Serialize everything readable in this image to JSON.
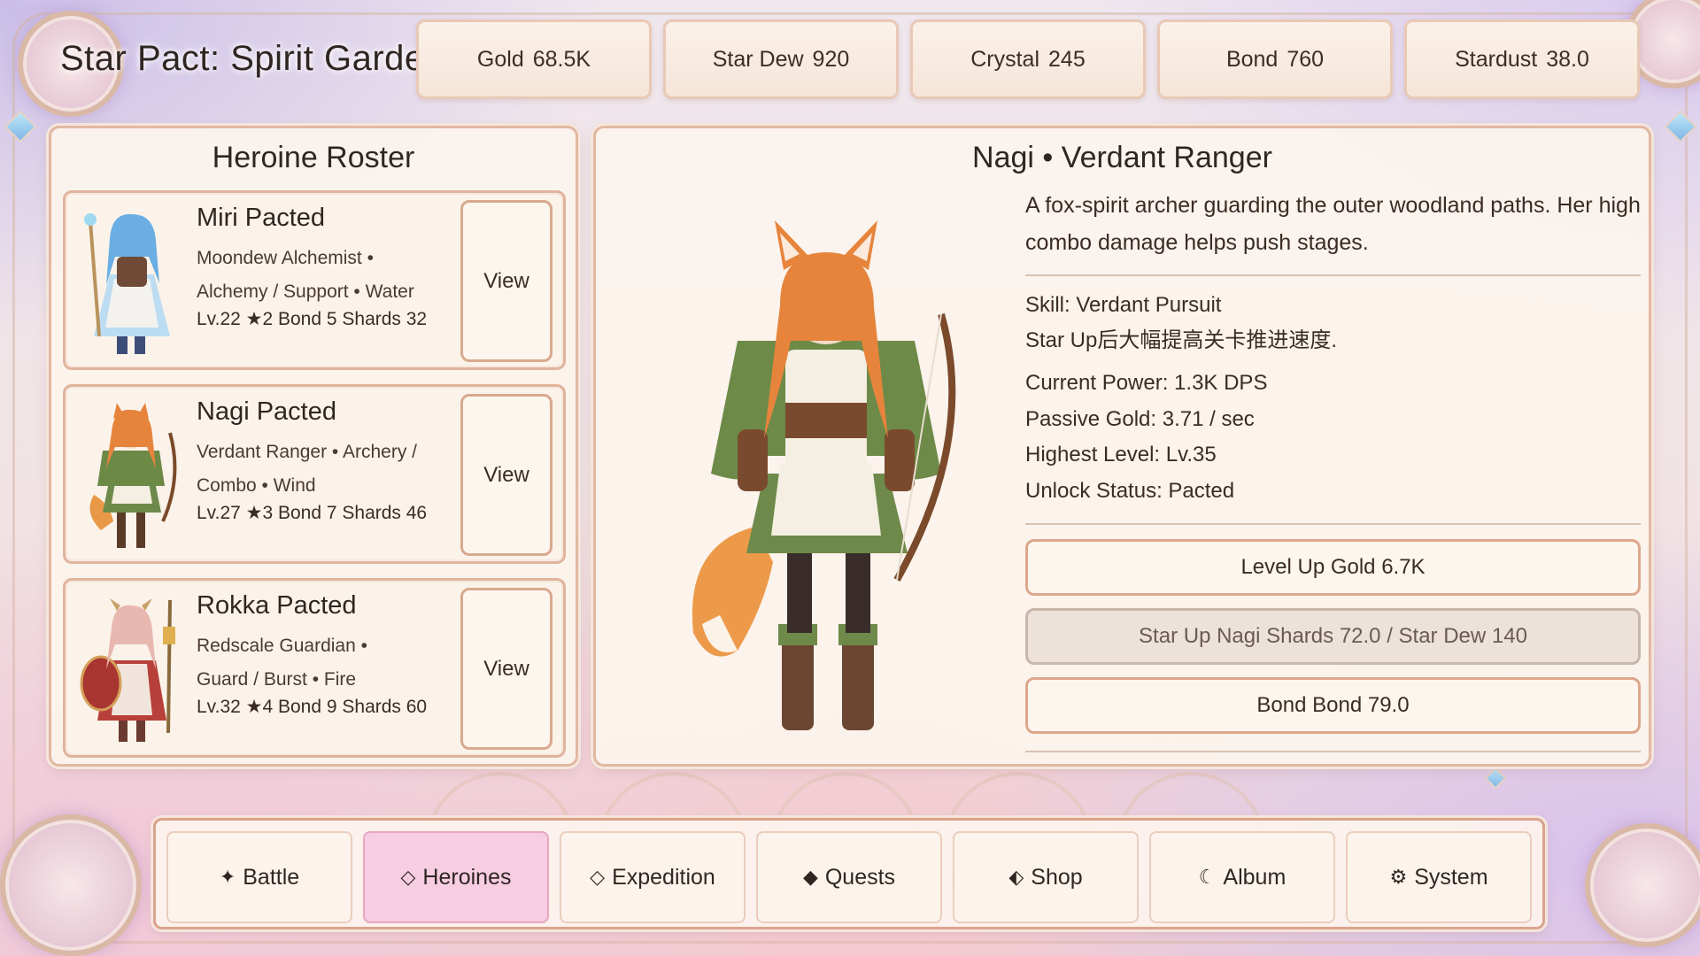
{
  "title": "Star Pact: Spirit Garden",
  "resources": [
    {
      "name": "Gold",
      "value": "68.5K"
    },
    {
      "name": "Star Dew",
      "value": "920"
    },
    {
      "name": "Crystal",
      "value": "245"
    },
    {
      "name": "Bond",
      "value": "760"
    },
    {
      "name": "Stardust",
      "value": "38.0"
    }
  ],
  "roster": {
    "title": "Heroine Roster",
    "cards": [
      {
        "name": "Miri  Pacted",
        "info1": "Moondew Alchemist  •",
        "info2": "Alchemy / Support  •  Water",
        "stats": "Lv.22  ★2  Bond 5  Shards 32",
        "view": "View"
      },
      {
        "name": "Nagi  Pacted",
        "info1": "Verdant Ranger  •  Archery /",
        "info2": "Combo  •  Wind",
        "stats": "Lv.27  ★3  Bond 7  Shards 46",
        "view": "View"
      },
      {
        "name": "Rokka  Pacted",
        "info1": "Redscale Guardian  •",
        "info2": "Guard / Burst  •  Fire",
        "stats": "Lv.32  ★4  Bond 9  Shards 60",
        "view": "View"
      }
    ]
  },
  "detail": {
    "title": "Nagi  •  Verdant Ranger",
    "description": "A fox-spirit archer guarding the outer woodland paths. Her high combo damage helps push stages.",
    "skill_name": "Skill: Verdant Pursuit",
    "skill_desc": "Star Up后大幅提高关卡推进速度.",
    "stats": [
      "Current Power: 1.3K DPS",
      "Passive Gold: 3.71 / sec",
      "Highest Level: Lv.35",
      "Unlock Status: Pacted"
    ],
    "actions": {
      "level_up": "Level Up  Gold 6.7K",
      "star_up": "Star Up  Nagi Shards 72.0 / Star Dew 140",
      "bond": "Bond  Bond 79.0"
    }
  },
  "nav": [
    {
      "icon": "✦",
      "label": "Battle"
    },
    {
      "icon": "◇",
      "label": "Heroines"
    },
    {
      "icon": "◇",
      "label": "Expedition"
    },
    {
      "icon": "◆",
      "label": "Quests"
    },
    {
      "icon": "⬖",
      "label": "Shop"
    },
    {
      "icon": "☾",
      "label": "Album"
    },
    {
      "icon": "⚙",
      "label": "System"
    }
  ],
  "nav_active": "Heroines",
  "colors": {
    "accent_pink": "#f7cde2",
    "panel_border": "#e2b8a2",
    "panel_bg": "#fbf4ec"
  }
}
